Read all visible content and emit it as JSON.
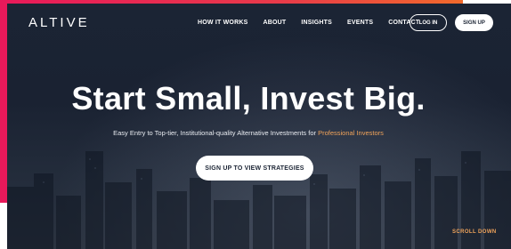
{
  "brand": {
    "logo": "ALTIVE"
  },
  "nav": {
    "links": [
      "HOW IT WORKS",
      "ABOUT",
      "INSIGHTS",
      "EVENTS",
      "CONTACT"
    ],
    "login_label": "LOG IN",
    "signup_label": "SIGN UP"
  },
  "hero": {
    "headline": "Start Small, Invest Big.",
    "subtitle_main": "Easy Entry to Top-tier, Institutional-quality Alternative Investments for ",
    "subtitle_highlight": "Professional Investors",
    "cta_label": "SIGN UP TO VIEW STRATEGIES",
    "scroll_label": "SCROLL DOWN"
  },
  "colors": {
    "accent": "#e8195a",
    "highlight": "#f0a35a",
    "hero_bg": "#1b2434"
  }
}
